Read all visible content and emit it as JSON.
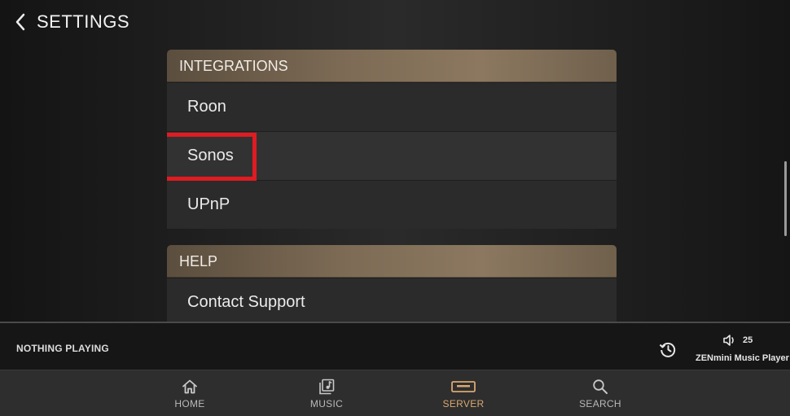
{
  "header": {
    "title": "SETTINGS",
    "back_icon": "chevron-left-icon"
  },
  "sections": [
    {
      "title": "INTEGRATIONS",
      "items": [
        {
          "label": "Roon"
        },
        {
          "label": "Sonos",
          "highlighted": true
        },
        {
          "label": "UPnP"
        }
      ]
    },
    {
      "title": "HELP",
      "items": [
        {
          "label": "Contact Support"
        }
      ]
    }
  ],
  "player": {
    "status": "NOTHING PLAYING",
    "volume": "25",
    "zone": "ZENmini Music Player",
    "history_icon": "history-icon",
    "volume_icon": "speaker-icon"
  },
  "nav": {
    "items": [
      {
        "label": "HOME",
        "icon": "home-icon"
      },
      {
        "label": "MUSIC",
        "icon": "music-library-icon"
      },
      {
        "label": "SERVER",
        "icon": "server-icon",
        "active": true
      },
      {
        "label": "SEARCH",
        "icon": "search-icon"
      }
    ]
  },
  "colors": {
    "accent": "#d9a870",
    "highlight_box": "#e11b22",
    "section_header": "#7d6b55"
  }
}
